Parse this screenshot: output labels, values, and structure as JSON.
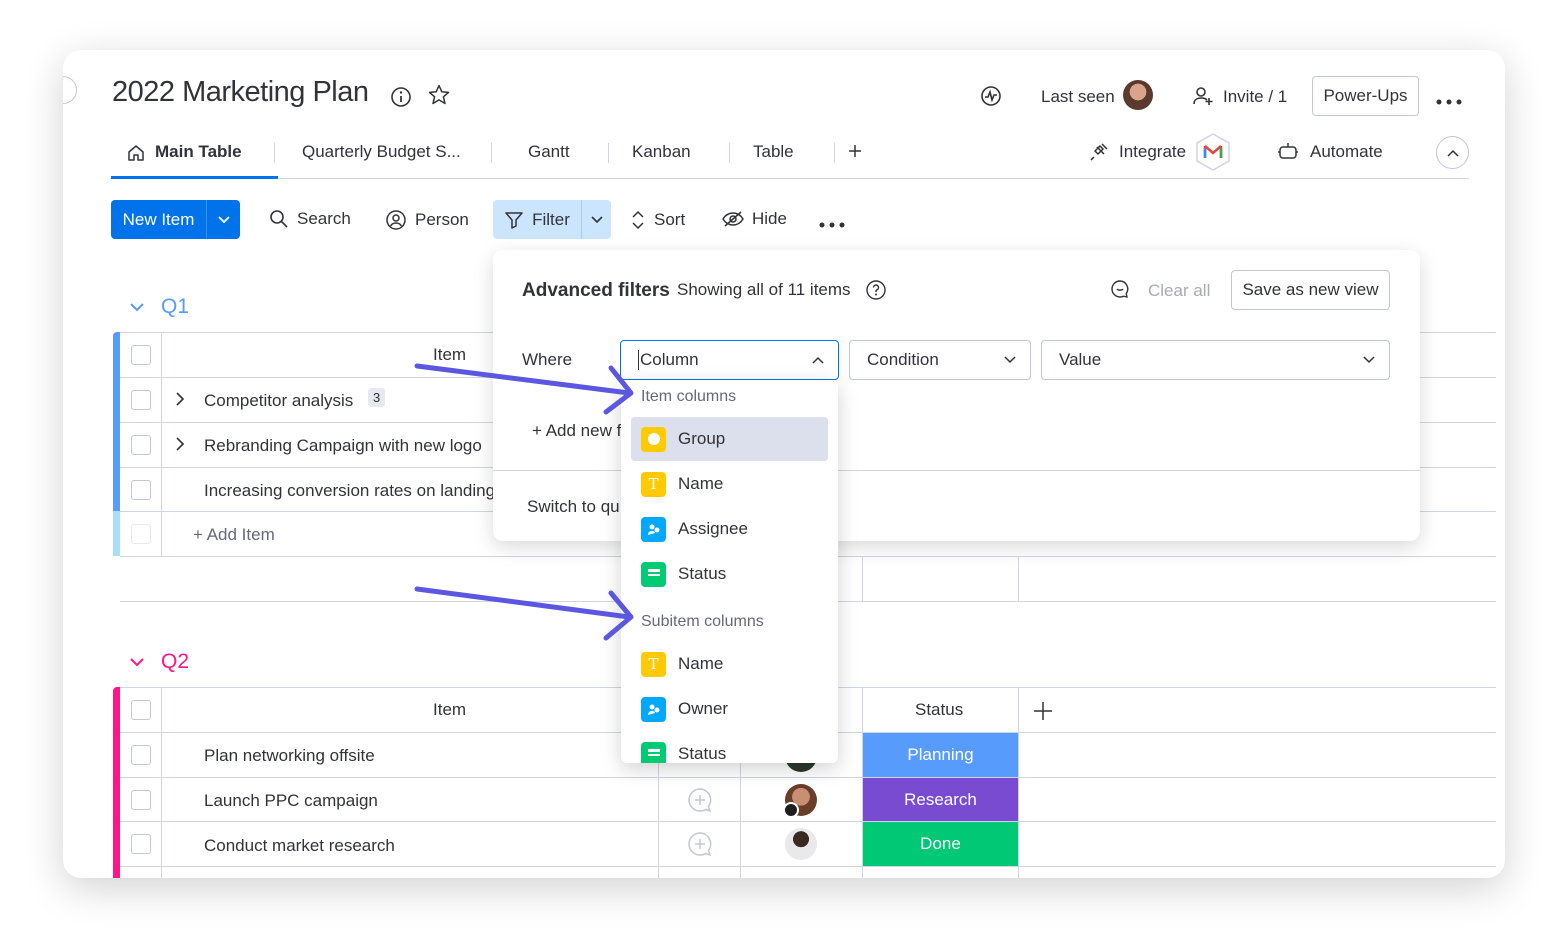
{
  "board": {
    "title": "2022 Marketing Plan",
    "last_seen_label": "Last seen",
    "invite_label": "Invite / 1",
    "powerups_label": "Power-Ups"
  },
  "tabs": [
    {
      "label": "Main Table"
    },
    {
      "label": "Quarterly Budget S..."
    },
    {
      "label": "Gantt"
    },
    {
      "label": "Kanban"
    },
    {
      "label": "Table"
    }
  ],
  "integrate_label": "Integrate",
  "automate_label": "Automate",
  "toolbar": {
    "new_item": "New Item",
    "search": "Search",
    "person": "Person",
    "filter": "Filter",
    "sort": "Sort",
    "hide": "Hide"
  },
  "groups": [
    {
      "name": "Q1",
      "color": "#579bfc",
      "item_header": "Item",
      "rows": [
        {
          "name": "Competitor analysis",
          "subitems": "3"
        },
        {
          "name": "Rebranding Campaign with new logo"
        },
        {
          "name": "Increasing conversion rates on landing pages"
        }
      ],
      "add_item": "+ Add Item"
    },
    {
      "name": "Q2",
      "color": "#ff158a",
      "item_header": "Item",
      "status_header": "Status",
      "rows": [
        {
          "name": "Plan networking offsite",
          "status": "Planning",
          "status_color": "#579bfc"
        },
        {
          "name": "Launch PPC campaign",
          "status": "Research",
          "status_color": "#784bd1"
        },
        {
          "name": "Conduct market research",
          "status": "Done",
          "status_color": "#00c875"
        }
      ]
    }
  ],
  "filters": {
    "title": "Advanced filters",
    "subtitle": "Showing all of 11 items",
    "clear_all": "Clear all",
    "save_view": "Save as new view",
    "where": "Where",
    "column_placeholder": "Column",
    "condition_placeholder": "Condition",
    "value_placeholder": "Value",
    "add_new": "+ Add new f",
    "switch_to": "Switch to qu"
  },
  "column_menu": {
    "item_columns_header": "Item columns",
    "item_columns": [
      {
        "label": "Group",
        "icon": "group-icon",
        "color": "#ffcb00"
      },
      {
        "label": "Name",
        "icon": "text-icon",
        "color": "#ffcb00"
      },
      {
        "label": "Assignee",
        "icon": "people-icon",
        "color": "#00a9ff"
      },
      {
        "label": "Status",
        "icon": "status-icon",
        "color": "#00ca72"
      }
    ],
    "subitem_columns_header": "Subitem columns",
    "subitem_columns": [
      {
        "label": "Name",
        "icon": "text-icon",
        "color": "#ffcb00"
      },
      {
        "label": "Owner",
        "icon": "people-icon",
        "color": "#00a9ff"
      },
      {
        "label": "Status",
        "icon": "status-icon",
        "color": "#00ca72"
      }
    ]
  }
}
